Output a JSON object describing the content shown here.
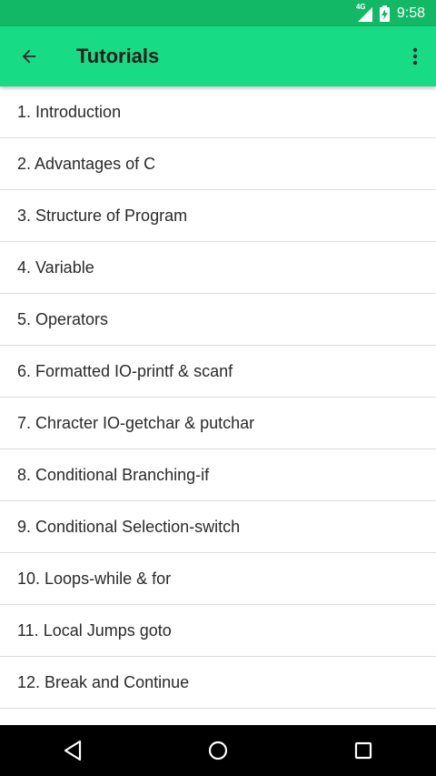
{
  "status_bar": {
    "network": "4G",
    "time": "9:58"
  },
  "app_bar": {
    "title": "Tutorials",
    "back_icon": "arrow-back-icon",
    "menu_icon": "more-vert-icon",
    "color": "#18dc85"
  },
  "tutorials": [
    "1. Introduction",
    "2. Advantages of C",
    "3. Structure of Program",
    "4. Variable",
    "5. Operators",
    "6. Formatted IO-printf & scanf",
    "7. Chracter IO-getchar & putchar",
    "8. Conditional Branching-if",
    "9. Conditional Selection-switch",
    "10. Loops-while & for",
    "11. Local Jumps goto",
    "12. Break and Continue",
    ""
  ],
  "nav_bar": {
    "back_icon": "nav-back-icon",
    "home_icon": "nav-home-icon",
    "recents_icon": "nav-recents-icon"
  }
}
